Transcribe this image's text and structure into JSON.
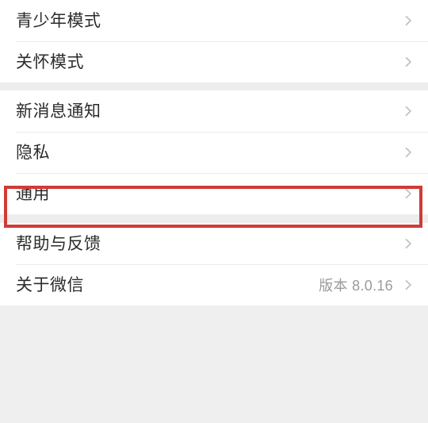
{
  "screen": {
    "title": "微信设置",
    "background_color": "#ffffff",
    "group_gap_color": "#ededed",
    "divider_color": "#ececec",
    "label_color": "#2b2b2b",
    "value_color": "#9b9b9b",
    "chevron_color": "#c3c3c3",
    "highlight_color": "#d03b36"
  },
  "groups": [
    {
      "name": "modes-group",
      "rows": [
        {
          "label": "青少年模式",
          "value": "",
          "chevron": "chevron-right-icon"
        },
        {
          "label": "关怀模式",
          "value": "",
          "chevron": "chevron-right-icon"
        }
      ]
    },
    {
      "name": "core-settings-group",
      "rows": [
        {
          "label": "新消息通知",
          "value": "",
          "chevron": "chevron-right-icon"
        },
        {
          "label": "隐私",
          "value": "",
          "chevron": "chevron-right-icon",
          "highlighted": true
        },
        {
          "label": "通用",
          "value": "",
          "chevron": "chevron-right-icon"
        }
      ]
    },
    {
      "name": "support-group",
      "rows": [
        {
          "label": "帮助与反馈",
          "value": "",
          "chevron": "chevron-right-icon"
        },
        {
          "label": "关于微信",
          "value": "版本 8.0.16",
          "chevron": "chevron-right-icon"
        }
      ]
    }
  ]
}
